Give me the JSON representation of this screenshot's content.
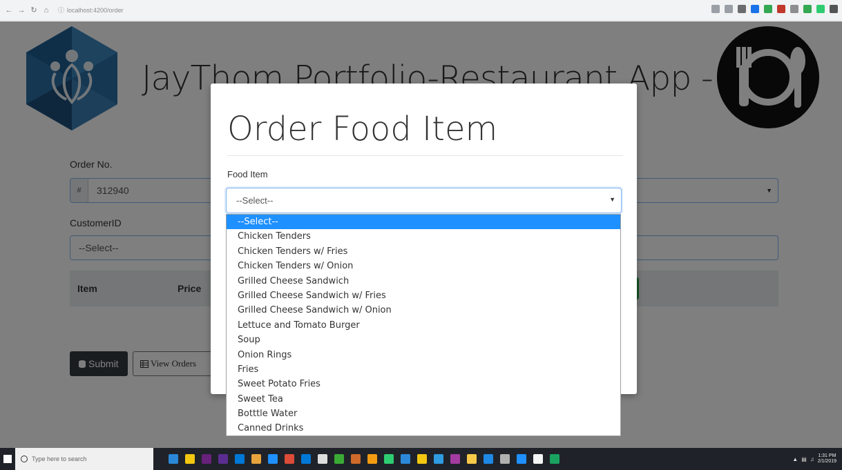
{
  "browser": {
    "url": "localhost:4200/order",
    "ext_colors": [
      "#9aa0a6",
      "#9aa0a6",
      "#6c6c6c",
      "#1a73e8",
      "#34a853",
      "#c0392b",
      "#8e8e8e",
      "#34a853",
      "#2ecc71",
      "#555555"
    ]
  },
  "app": {
    "title": "JayThom Portfolio-Restaurant App -"
  },
  "form": {
    "order_no_label": "Order No.",
    "order_no_prefix": "#",
    "order_no_value": "312940",
    "customer_label": "CustomerID",
    "customer_value": "--Select--"
  },
  "table": {
    "col_item": "Item",
    "col_price": "Price"
  },
  "buttons": {
    "submit_label": "Submit",
    "view_orders_label": "View Orders"
  },
  "modal": {
    "title": "Order Food Item",
    "food_item_label": "Food Item",
    "food_item_value": "--Select--",
    "options": [
      "--Select--",
      "Chicken Tenders",
      "Chicken Tenders w/ Fries",
      "Chicken Tenders w/ Onion",
      "Grilled Cheese Sandwich",
      "Grilled Cheese Sandwich w/ Fries",
      "Grilled Cheese Sandwich w/ Onion",
      "Lettuce and Tomato Burger",
      "Soup",
      "Onion Rings",
      "Fries",
      "Sweet Potato Fries",
      "Sweet Tea",
      "Botttle Water",
      "Canned Drinks"
    ],
    "selected_index": 0
  },
  "taskbar": {
    "search_placeholder": "Type here to search",
    "time": "1:31 PM",
    "date": "2/1/2019",
    "app_colors": [
      "#2b88d8",
      "#f2c811",
      "#68217a",
      "#5c2d91",
      "#0078d7",
      "#e8a33d",
      "#1e90ff",
      "#dd4b39",
      "#0078d7",
      "#dddddd",
      "#3aaa35",
      "#cf6a2a",
      "#f39c12",
      "#2ecc71",
      "#2b88d8",
      "#f2c811",
      "#2f9be0",
      "#a33ba1",
      "#f7c948",
      "#1e88e5",
      "#b0b0b0",
      "#1e90ff",
      "#f5f5f5",
      "#1aa260"
    ]
  }
}
